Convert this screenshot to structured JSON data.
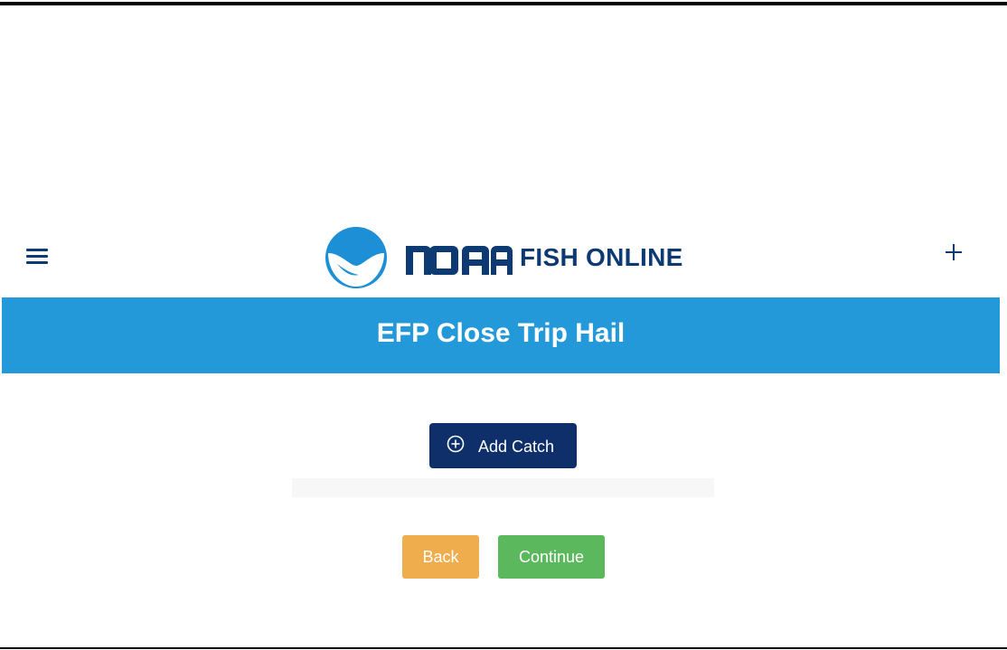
{
  "header": {
    "menu_icon": "hamburger-menu-icon",
    "logo": {
      "emblem_icon": "noaa-emblem-icon",
      "wordmark": "NOAA",
      "product_name": "FISH ONLINE"
    },
    "add_icon": "plus-icon"
  },
  "banner": {
    "title": "EFP Close Trip Hail"
  },
  "main": {
    "add_catch_label": "Add Catch",
    "add_catch_icon": "circle-plus-icon"
  },
  "footer_actions": {
    "back_label": "Back",
    "continue_label": "Continue"
  },
  "colors": {
    "banner": "#2499d9",
    "brand_navy": "#0e3a73",
    "primary_button": "#0e2f6a",
    "back_button": "#efad4e",
    "continue_button": "#5cb85c"
  }
}
